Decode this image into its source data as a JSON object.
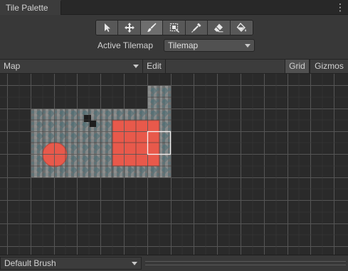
{
  "window": {
    "tab_title": "Tile Palette",
    "menu_icon": "kebab-menu-icon"
  },
  "toolbar": {
    "tools": [
      {
        "name": "select-tool",
        "icon": "arrow-cursor-icon"
      },
      {
        "name": "move-tool",
        "icon": "move-arrows-icon"
      },
      {
        "name": "paint-tool",
        "icon": "paint-brush-icon",
        "active": true
      },
      {
        "name": "box-fill-tool",
        "icon": "box-fill-icon"
      },
      {
        "name": "picker-tool",
        "icon": "eyedropper-icon"
      },
      {
        "name": "erase-tool",
        "icon": "eraser-icon"
      },
      {
        "name": "flood-fill-tool",
        "icon": "paint-bucket-icon"
      }
    ]
  },
  "active_tilemap": {
    "label": "Active Tilemap",
    "value": "Tilemap"
  },
  "palette_bar": {
    "palette_value": "Map",
    "edit_label": "Edit",
    "grid_label": "Grid",
    "gizmos_label": "Gizmos"
  },
  "bottom_bar": {
    "brush_value": "Default Brush"
  },
  "colors": {
    "accent_tile": "#e8594b",
    "grid_line": "#5a5a5a",
    "background": "#2a2a2a"
  }
}
